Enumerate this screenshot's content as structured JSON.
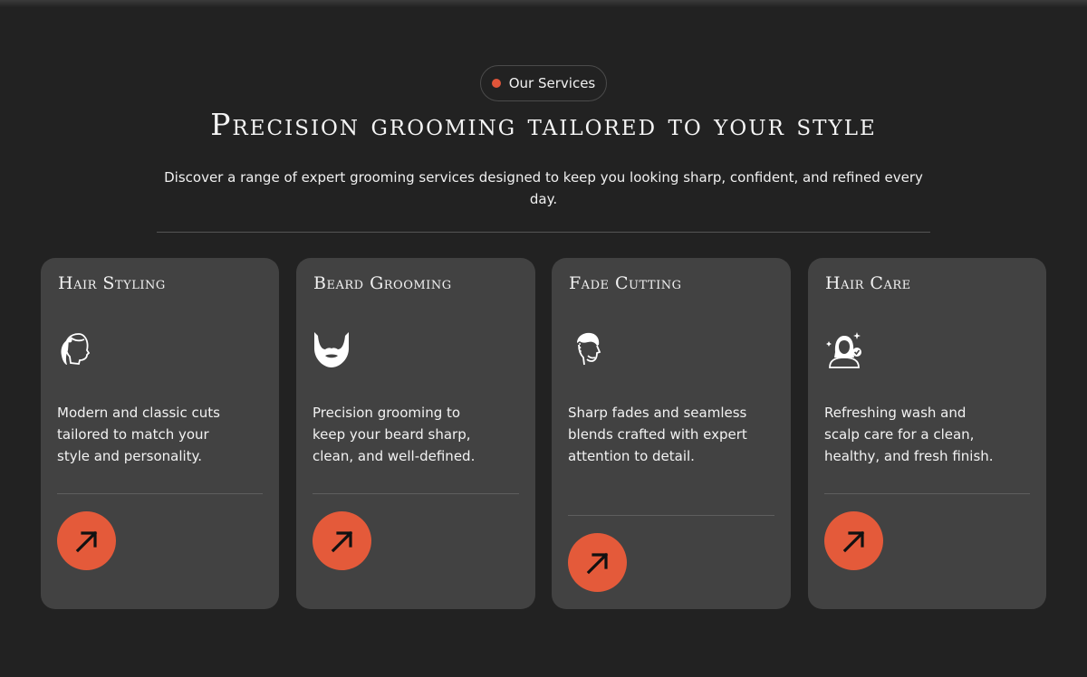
{
  "badge": {
    "label": "Our Services",
    "dot_color": "#e0553a"
  },
  "heading": "Precision grooming tailored to your style",
  "subtext": "Discover a range of expert grooming services designed to keep you looking sharp, confident, and refined every day.",
  "accent_color": "#e45a3a",
  "cards": [
    {
      "title": "Hair Styling",
      "icon": "ponytail-hair-icon",
      "description": "Modern and classic cuts tailored to match your style and personality."
    },
    {
      "title": "Beard Grooming",
      "icon": "beard-icon",
      "description": "Precision grooming to keep your beard sharp, clean, and well-defined."
    },
    {
      "title": "Fade Cutting",
      "icon": "fade-haircut-icon",
      "description": "Sharp fades and seamless blends crafted with expert attention to detail."
    },
    {
      "title": "Hair Care",
      "icon": "hair-care-icon",
      "description": "Refreshing wash and scalp care for a clean, healthy, and fresh finish."
    }
  ]
}
